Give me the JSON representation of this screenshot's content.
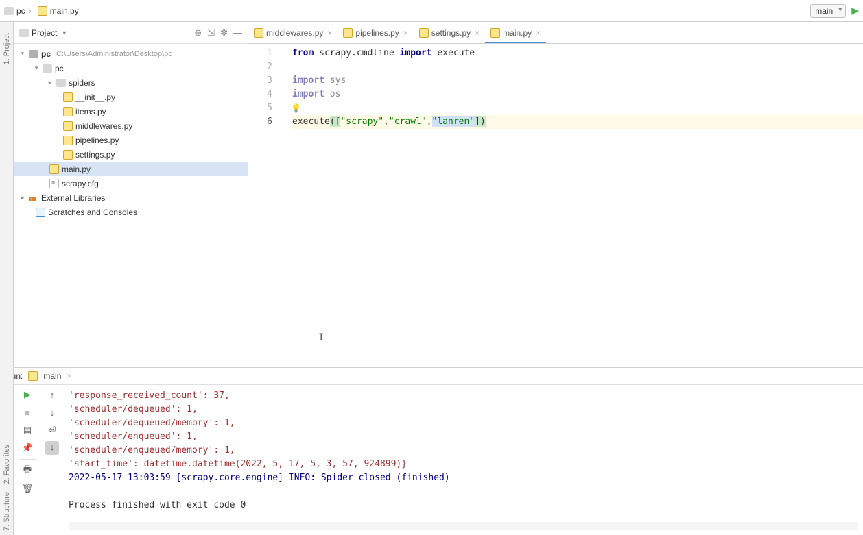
{
  "breadcrumb": {
    "root": "pc",
    "file": "main.py"
  },
  "run_config": {
    "selected": "main"
  },
  "project_panel": {
    "title": "Project"
  },
  "tree": {
    "root": {
      "name": "pc",
      "path": "C:\\Users\\Administrator\\Desktop\\pc"
    },
    "pkg": "pc",
    "spiders": "spiders",
    "files": {
      "init": "__init__.py",
      "items": "items.py",
      "middlewares": "middlewares.py",
      "pipelines": "pipelines.py",
      "settings": "settings.py",
      "main": "main.py",
      "cfg": "scrapy.cfg"
    },
    "ext_lib": "External Libraries",
    "scratches": "Scratches and Consoles"
  },
  "tabs": [
    {
      "label": "middlewares.py"
    },
    {
      "label": "pipelines.py"
    },
    {
      "label": "settings.py"
    },
    {
      "label": "main.py"
    }
  ],
  "code": {
    "kw_from": "from",
    "mod_scrapy": " scrapy.cmdline ",
    "kw_import": "import",
    "fn_execute": " execute",
    "mod_sys": " sys",
    "mod_os": " os",
    "fn_exec_call": "execute",
    "str_scrapy": "\"scrapy\"",
    "str_crawl": "\"crawl\"",
    "str_lanren": "\"lanren\"",
    "comma": ",",
    "lbrk": "([",
    "rbrk": "])"
  },
  "line_numbers": [
    "1",
    "2",
    "3",
    "4",
    "5",
    "6"
  ],
  "run": {
    "title": "Run:",
    "tab": "main",
    "output": [
      " 'response_received_count': 37,",
      " 'scheduler/dequeued': 1,",
      " 'scheduler/dequeued/memory': 1,",
      " 'scheduler/enqueued': 1,",
      " 'scheduler/enqueued/memory': 1,",
      " 'start_time': datetime.datetime(2022, 5, 17, 5, 3, 57, 924899)}"
    ],
    "info_line": "2022-05-17 13:03:59 [scrapy.core.engine] INFO: Spider closed (finished)",
    "exit_line": "Process finished with exit code 0"
  },
  "side_tabs": {
    "project": "1: Project",
    "favorites": "2: Favorites",
    "structure": "7: Structure"
  }
}
